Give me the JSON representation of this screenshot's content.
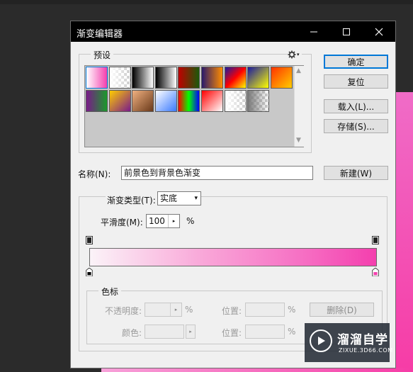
{
  "window": {
    "title": "渐变编辑器"
  },
  "buttons": {
    "ok": "确定",
    "reset": "复位",
    "load": "载入(L)...",
    "save": "存储(S)...",
    "new": "新建(W)",
    "delete": "删除(D)"
  },
  "presets": {
    "legend": "预设",
    "gear_icon": "gear-icon",
    "swatches": [
      {
        "colors": [
          "#ffffff",
          "#f43fae"
        ]
      },
      {
        "colors": [
          "#ffffff",
          "transparent"
        ]
      },
      {
        "colors": [
          "#000000",
          "#ffffff"
        ]
      },
      {
        "colors": [
          "#000000",
          "#ffffff"
        ]
      },
      {
        "colors": [
          "#c00000",
          "#1b5a0a"
        ]
      },
      {
        "colors": [
          "#2a1a6b",
          "#ff8c00"
        ]
      },
      {
        "colors": [
          "#1a1aa0",
          "#ff0000",
          "#ffff00"
        ]
      },
      {
        "colors": [
          "#1a1aa0",
          "#ffff00"
        ]
      },
      {
        "colors": [
          "#ff3300",
          "#ffcc00"
        ]
      },
      {
        "colors": [
          "#7a1a8a",
          "#1a9a2a"
        ]
      },
      {
        "colors": [
          "#ffcc00",
          "#7a1a8a"
        ]
      },
      {
        "colors": [
          "#f0b080",
          "#6a3a1a"
        ]
      },
      {
        "colors": [
          "#ffffff",
          "#3a7aff"
        ]
      },
      {
        "colors": [
          "#ff0000",
          "#00ff00",
          "#0000ff"
        ]
      },
      {
        "colors": [
          "#ff0000",
          "#ffffff"
        ]
      },
      {
        "colors": [
          "#ffffff",
          "transparent"
        ]
      },
      {
        "colors": [
          "#7a7a7a",
          "transparent"
        ]
      }
    ]
  },
  "name": {
    "label": "名称(N):",
    "value": "前景色到背景色渐变"
  },
  "gradient": {
    "type_label": "渐变类型(T):",
    "type_value": "实底",
    "smoothness_label": "平滑度(M):",
    "smoothness_value": "100",
    "smoothness_unit": "%",
    "start_color": "#fbf3f8",
    "end_color": "#f43fae"
  },
  "color_stops": {
    "legend": "色标",
    "opacity_label": "不透明度:",
    "opacity_unit": "%",
    "position_label": "位置:",
    "position_unit": "%",
    "color_label": "颜色:",
    "position2_label": "位置:",
    "position2_unit": "%"
  },
  "watermark": {
    "title": "溜溜自学",
    "subtitle": "ZIXUE.3D66.COM"
  }
}
